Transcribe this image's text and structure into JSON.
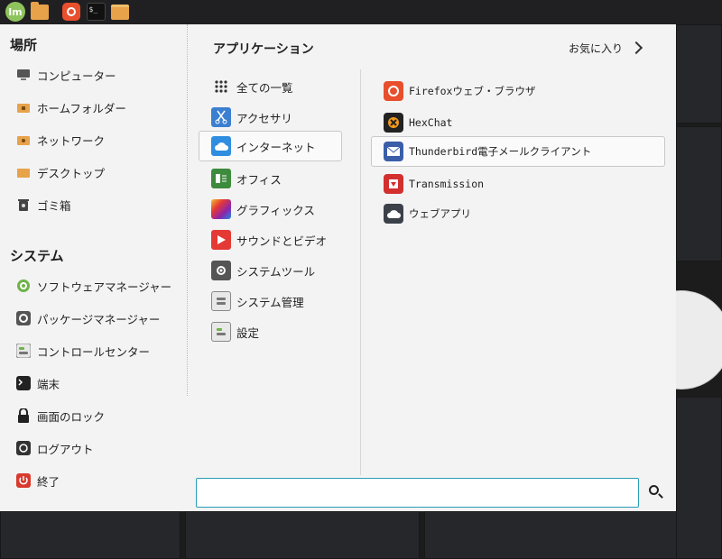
{
  "panel": {
    "launchers": [
      "mint-menu",
      "files",
      "firefox",
      "terminal",
      "home-folder"
    ],
    "terminal_glyph": "$_"
  },
  "sidebar": {
    "places_title": "場所",
    "places": [
      {
        "label": "コンピューター",
        "icon": "computer-icon"
      },
      {
        "label": "ホームフォルダー",
        "icon": "home-folder-icon"
      },
      {
        "label": "ネットワーク",
        "icon": "network-folder-icon"
      },
      {
        "label": "デスクトップ",
        "icon": "desktop-folder-icon"
      },
      {
        "label": "ゴミ箱",
        "icon": "trash-icon"
      }
    ],
    "system_title": "システム",
    "system": [
      {
        "label": "ソフトウェアマネージャー",
        "icon": "software-manager-icon"
      },
      {
        "label": "パッケージマネージャー",
        "icon": "package-manager-icon"
      },
      {
        "label": "コントロールセンター",
        "icon": "control-center-icon"
      },
      {
        "label": "端末",
        "icon": "terminal-icon"
      },
      {
        "label": "画面のロック",
        "icon": "lock-icon"
      },
      {
        "label": "ログアウト",
        "icon": "logout-icon"
      },
      {
        "label": "終了",
        "icon": "power-icon"
      }
    ]
  },
  "main": {
    "title": "アプリケーション",
    "favorites_label": "お気に入り",
    "categories": [
      {
        "label": "全ての一覧",
        "icon": "grid-icon"
      },
      {
        "label": "アクセサリ",
        "icon": "accessories-icon"
      },
      {
        "label": "インターネット",
        "icon": "internet-icon"
      },
      {
        "label": "オフィス",
        "icon": "office-icon"
      },
      {
        "label": "グラフィックス",
        "icon": "graphics-icon"
      },
      {
        "label": "サウンドとビデオ",
        "icon": "sound-video-icon"
      },
      {
        "label": "システムツール",
        "icon": "system-tools-icon"
      },
      {
        "label": "システム管理",
        "icon": "administration-icon"
      },
      {
        "label": "設定",
        "icon": "settings-icon"
      }
    ],
    "selected_category": "インターネット",
    "apps": [
      {
        "name": "Firefox",
        "suffix": " ウェブ・ブラウザ",
        "icon": "firefox-icon"
      },
      {
        "name": "HexChat",
        "suffix": "",
        "icon": "hexchat-icon"
      },
      {
        "name": "Thunderbird",
        "suffix": "電子メールクライアント",
        "icon": "thunderbird-icon"
      },
      {
        "name": "Transmission",
        "suffix": "",
        "icon": "transmission-icon"
      },
      {
        "name": "",
        "suffix": "ウェブアプリ",
        "icon": "webapp-icon"
      }
    ],
    "search_value": "",
    "search_placeholder": ""
  },
  "colors": {
    "accent": "#2a9db5",
    "menu_bg": "#f3f3f3",
    "panel_bg": "#202022",
    "mint_green": "#8fc45d"
  }
}
